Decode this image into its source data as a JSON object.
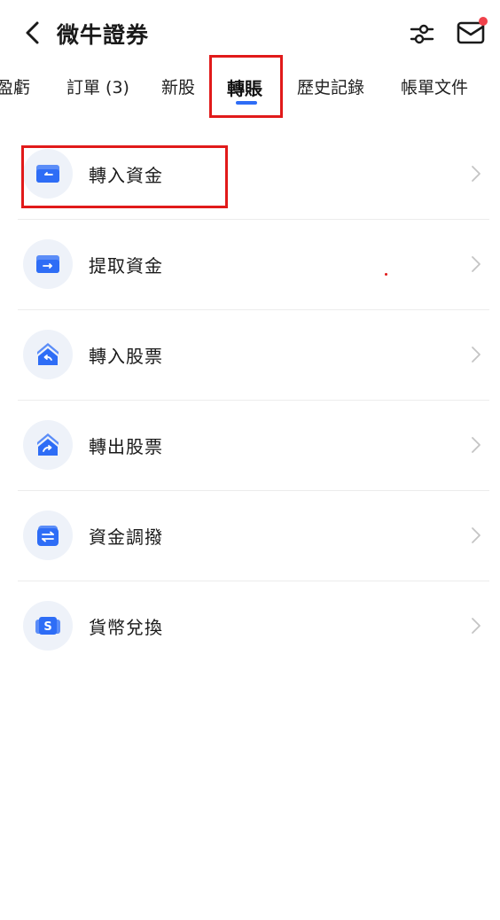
{
  "header": {
    "title": "微牛證券",
    "back_icon": "chevron-left-icon",
    "filter_icon": "sliders-icon",
    "mail_icon": "mail-icon",
    "mail_badge_color": "#f0424b"
  },
  "tabs": [
    {
      "label": "盈虧"
    },
    {
      "label": "訂單 (3)"
    },
    {
      "label": "新股"
    },
    {
      "label": "轉賬",
      "active": true
    },
    {
      "label": "歷史記錄"
    },
    {
      "label": "帳單文件"
    }
  ],
  "accent_color": "#2e6df6",
  "highlight_color": "#e11a1a",
  "menu": [
    {
      "label": "轉入資金",
      "icon": "deposit-funds-icon"
    },
    {
      "label": "提取資金",
      "icon": "withdraw-funds-icon"
    },
    {
      "label": "轉入股票",
      "icon": "transfer-in-stocks-icon"
    },
    {
      "label": "轉出股票",
      "icon": "transfer-out-stocks-icon"
    },
    {
      "label": "資金調撥",
      "icon": "fund-allocation-icon"
    },
    {
      "label": "貨幣兌換",
      "icon": "currency-exchange-icon"
    }
  ]
}
